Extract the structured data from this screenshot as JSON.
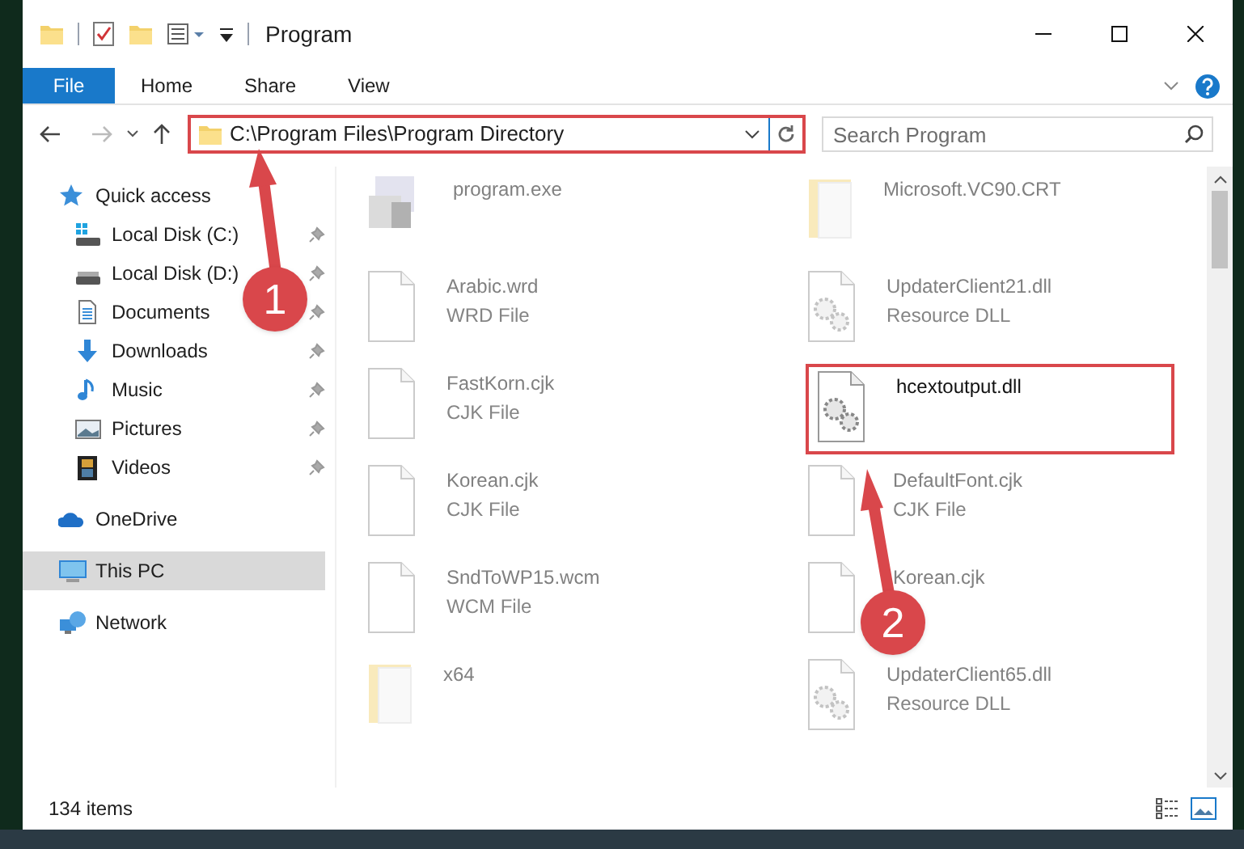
{
  "window": {
    "title": "Program"
  },
  "ribbon_tabs": [
    {
      "label": "File",
      "selected": true
    },
    {
      "label": "Home",
      "selected": false
    },
    {
      "label": "Share",
      "selected": false
    },
    {
      "label": "View",
      "selected": false
    }
  ],
  "address": {
    "path": "C:\\Program Files\\Program Directory",
    "highlighted": true
  },
  "search": {
    "placeholder": "Search Program"
  },
  "sidebar": {
    "items": [
      {
        "label": "Quick access",
        "kind": "star",
        "selected": false,
        "pinned": false,
        "children": [
          {
            "label": "Local Disk (C:)",
            "kind": "disk-c",
            "selected": false,
            "pinned": true
          },
          {
            "label": "Local Disk (D:)",
            "kind": "disk",
            "selected": false,
            "pinned": true
          },
          {
            "label": "Documents",
            "kind": "documents",
            "selected": false,
            "pinned": true
          },
          {
            "label": "Downloads",
            "kind": "downloads",
            "selected": false,
            "pinned": true
          },
          {
            "label": "Music",
            "kind": "music",
            "selected": false,
            "pinned": true
          },
          {
            "label": "Pictures",
            "kind": "pictures",
            "selected": false,
            "pinned": true
          },
          {
            "label": "Videos",
            "kind": "videos",
            "selected": false,
            "pinned": true
          }
        ]
      },
      {
        "label": "OneDrive",
        "kind": "cloud",
        "selected": false,
        "pinned": false
      },
      {
        "label": "This PC",
        "kind": "pc",
        "selected": true,
        "pinned": false
      },
      {
        "label": "Network",
        "kind": "network",
        "selected": false,
        "pinned": false
      }
    ]
  },
  "files": [
    {
      "name": "program.exe",
      "kind": "exe",
      "highlighted": false
    },
    {
      "name": "Microsoft.VC90.CRT",
      "kind": "folder",
      "highlighted": false
    },
    {
      "name": "Arabic.wrd",
      "type": "WRD File",
      "kind": "file",
      "highlighted": false
    },
    {
      "name": "UpdaterClient21.dll",
      "type": "Resource DLL",
      "kind": "dll",
      "highlighted": false
    },
    {
      "name": "FastKorn.cjk",
      "type": "CJK File",
      "kind": "file",
      "highlighted": false
    },
    {
      "name": "hcextoutput.dll",
      "kind": "dll",
      "highlighted": true
    },
    {
      "name": "Korean.cjk",
      "type": "CJK File",
      "kind": "file",
      "highlighted": false
    },
    {
      "name": "DefaultFont.cjk",
      "type": "CJK File",
      "kind": "file",
      "highlighted": false
    },
    {
      "name": "SndToWP15.wcm",
      "type": "WCM File",
      "kind": "file",
      "highlighted": false
    },
    {
      "name": "Korean.cjk",
      "kind": "file",
      "highlighted": false
    },
    {
      "name": "x64",
      "kind": "folder",
      "highlighted": false
    },
    {
      "name": "UpdaterClient65.dll",
      "type": "Resource DLL",
      "kind": "dll",
      "highlighted": false
    }
  ],
  "callouts": [
    {
      "number": "1"
    },
    {
      "number": "2"
    }
  ],
  "status_bar": {
    "count": "134 items"
  }
}
